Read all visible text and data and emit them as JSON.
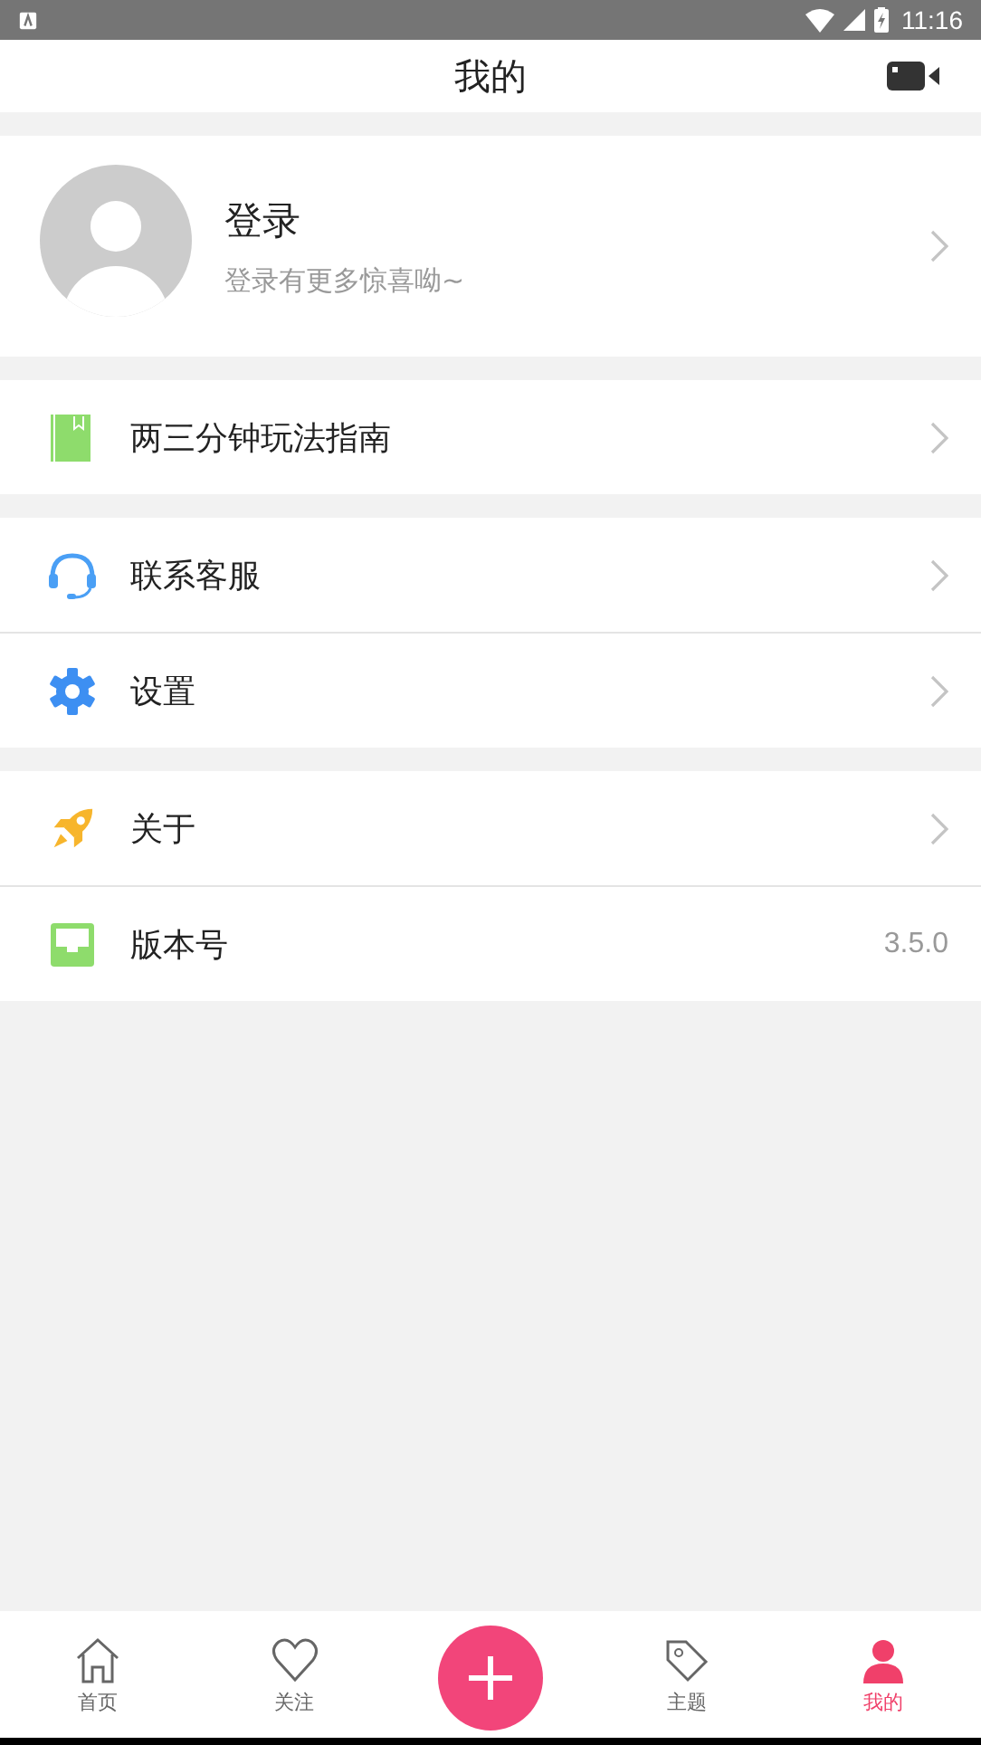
{
  "status_bar": {
    "time": "11:16"
  },
  "header": {
    "title": "我的"
  },
  "profile": {
    "name": "登录",
    "subtitle": "登录有更多惊喜呦~"
  },
  "menu_groups": [
    [
      {
        "kind": "guide",
        "label": "两三分钟玩法指南",
        "arrow": true
      }
    ],
    [
      {
        "kind": "service",
        "label": "联系客服",
        "arrow": true
      },
      {
        "kind": "settings",
        "label": "设置",
        "arrow": true
      }
    ],
    [
      {
        "kind": "about",
        "label": "关于",
        "arrow": true
      },
      {
        "kind": "version",
        "label": "版本号",
        "value": "3.5.0",
        "arrow": false
      }
    ]
  ],
  "tab_bar": [
    {
      "kind": "home",
      "label": "首页",
      "selected": false
    },
    {
      "kind": "heart",
      "label": "关注",
      "selected": false
    },
    {
      "kind": "add",
      "selected": false
    },
    {
      "kind": "tag",
      "label": "主题",
      "selected": false
    },
    {
      "kind": "user",
      "label": "我的",
      "selected": true
    }
  ]
}
